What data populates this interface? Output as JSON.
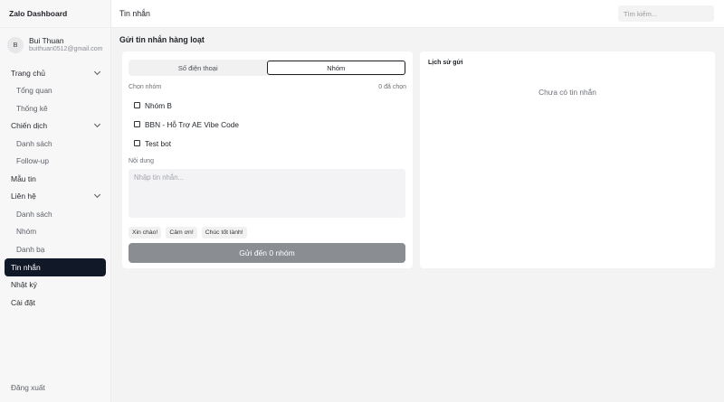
{
  "brand": "Zalo Dashboard",
  "user": {
    "initial": "B",
    "name": "Bui Thuan",
    "email": "buithuan0512@gmail.com"
  },
  "nav": {
    "home": "Trang chủ",
    "overview": "Tổng quan",
    "stats": "Thống kê",
    "campaigns": "Chiến dịch",
    "campaign_list": "Danh sách",
    "followup": "Follow-up",
    "templates": "Mẫu tin",
    "contacts": "Liên hệ",
    "contact_list": "Danh sách",
    "contact_groups": "Nhóm",
    "phonebook": "Danh bạ",
    "messages": "Tin nhắn",
    "log": "Nhật ký",
    "settings": "Cài đặt",
    "logout": "Đăng xuất"
  },
  "topbar": {
    "title": "Tin nhắn",
    "search_placeholder": "Tìm kiếm..."
  },
  "page": {
    "title": "Gửi tin nhắn hàng loạt"
  },
  "compose": {
    "tab_phone": "Số điện thoại",
    "tab_group": "Nhóm",
    "choose_group_label": "Chọn nhóm",
    "selected_count": "0 đã chọn",
    "groups": [
      "Nhóm B",
      "BBN - Hỗ Trợ AE Vibe Code",
      "Test bot"
    ],
    "content_label": "Nội dung",
    "content_placeholder": "Nhập tin nhắn...",
    "quick_replies": [
      "Xin chào!",
      "Cảm ơn!",
      "Chúc tốt lành!"
    ],
    "send_label": "Gửi đến 0 nhóm"
  },
  "history": {
    "title": "Lịch sử gửi",
    "empty": "Chưa có tin nhắn"
  }
}
